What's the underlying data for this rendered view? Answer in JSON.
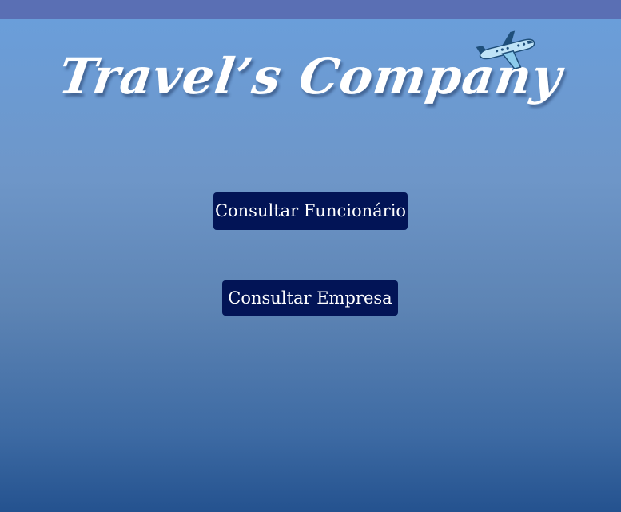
{
  "header": {
    "title": "Travel’s Company",
    "icon": "airplane-icon"
  },
  "actions": {
    "consultar_funcionario": "Consultar Funcionário",
    "consultar_empresa": "Consultar Empresa"
  },
  "colors": {
    "top_bar": "#5a6fb4",
    "button_bg": "#021456",
    "button_text": "#ffffff",
    "title_text": "#ffffff",
    "bg_top": "#6a9fdc",
    "bg_bottom": "#24528f"
  }
}
